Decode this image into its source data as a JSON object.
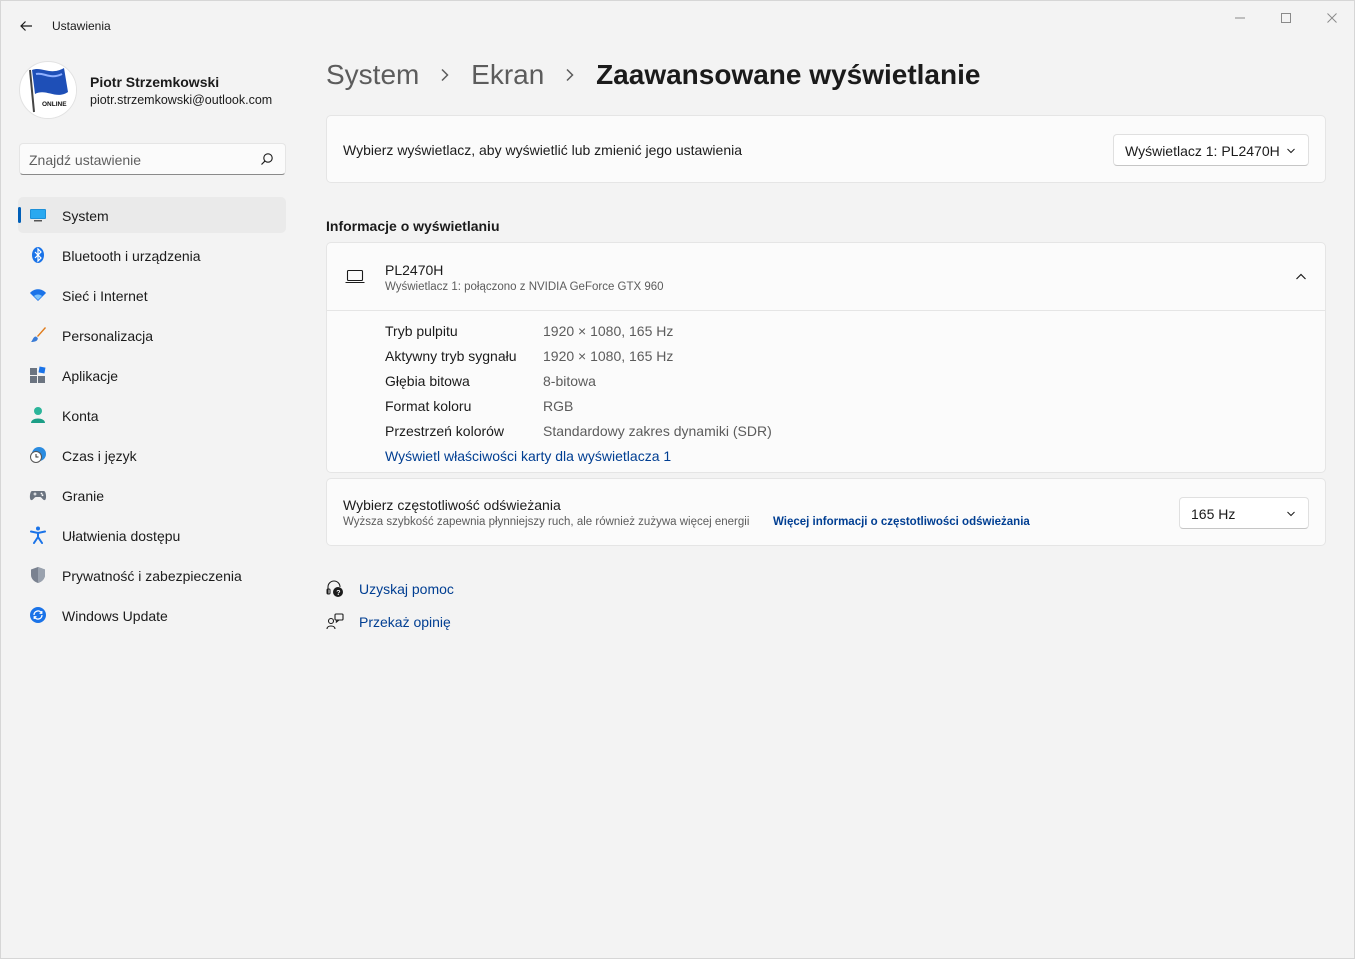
{
  "window": {
    "title": "Ustawienia",
    "icons": {
      "back": "back-arrow-icon",
      "minimize": "minimize-icon",
      "maximize": "maximize-icon",
      "close": "close-icon"
    }
  },
  "profile": {
    "name": "Piotr Strzemkowski",
    "email": "piotr.strzemkowski@outlook.com",
    "avatar_text": "ONLINE"
  },
  "search": {
    "placeholder": "Znajdź ustawienie"
  },
  "sidebar": {
    "items": [
      {
        "label": "System",
        "icon": "monitor-icon",
        "active": true
      },
      {
        "label": "Bluetooth i urządzenia",
        "icon": "bluetooth-icon"
      },
      {
        "label": "Sieć i Internet",
        "icon": "wifi-icon"
      },
      {
        "label": "Personalizacja",
        "icon": "brush-icon"
      },
      {
        "label": "Aplikacje",
        "icon": "apps-icon"
      },
      {
        "label": "Konta",
        "icon": "person-icon"
      },
      {
        "label": "Czas i język",
        "icon": "clock-globe-icon"
      },
      {
        "label": "Granie",
        "icon": "gamepad-icon"
      },
      {
        "label": "Ułatwienia dostępu",
        "icon": "accessibility-icon"
      },
      {
        "label": "Prywatność i zabezpieczenia",
        "icon": "shield-icon"
      },
      {
        "label": "Windows Update",
        "icon": "update-icon"
      }
    ]
  },
  "breadcrumb": {
    "items": [
      "System",
      "Ekran",
      "Zaawansowane wyświetlanie"
    ]
  },
  "select_display": {
    "label": "Wybierz wyświetlacz, aby wyświetlić lub zmienić jego ustawienia",
    "value": "Wyświetlacz 1: PL2470H"
  },
  "display_info": {
    "section_title": "Informacje o wyświetlaniu",
    "monitor_name": "PL2470H",
    "monitor_subtitle": "Wyświetlacz 1: połączono z NVIDIA GeForce GTX 960",
    "rows": [
      {
        "label": "Tryb pulpitu",
        "value": "1920 × 1080, 165 Hz"
      },
      {
        "label": "Aktywny tryb sygnału",
        "value": "1920 × 1080, 165 Hz"
      },
      {
        "label": "Głębia bitowa",
        "value": "8-bitowa"
      },
      {
        "label": "Format koloru",
        "value": "RGB"
      },
      {
        "label": "Przestrzeń kolorów",
        "value": "Standardowy zakres dynamiki (SDR)"
      }
    ],
    "adapter_link": "Wyświetl właściwości karty dla wyświetlacza 1"
  },
  "refresh_rate": {
    "title": "Wybierz częstotliwość odświeżania",
    "description": "Wyższa szybkość zapewnia płynniejszy ruch, ale również zużywa więcej energii",
    "more_link": "Więcej informacji o częstotliwości odświeżania",
    "value": "165 Hz"
  },
  "footer": {
    "help": "Uzyskaj pomoc",
    "feedback": "Przekaż opinię"
  },
  "colors": {
    "accent": "#005fb8",
    "link": "#003e92",
    "background": "#f3f3f3",
    "card": "#fbfbfb"
  }
}
